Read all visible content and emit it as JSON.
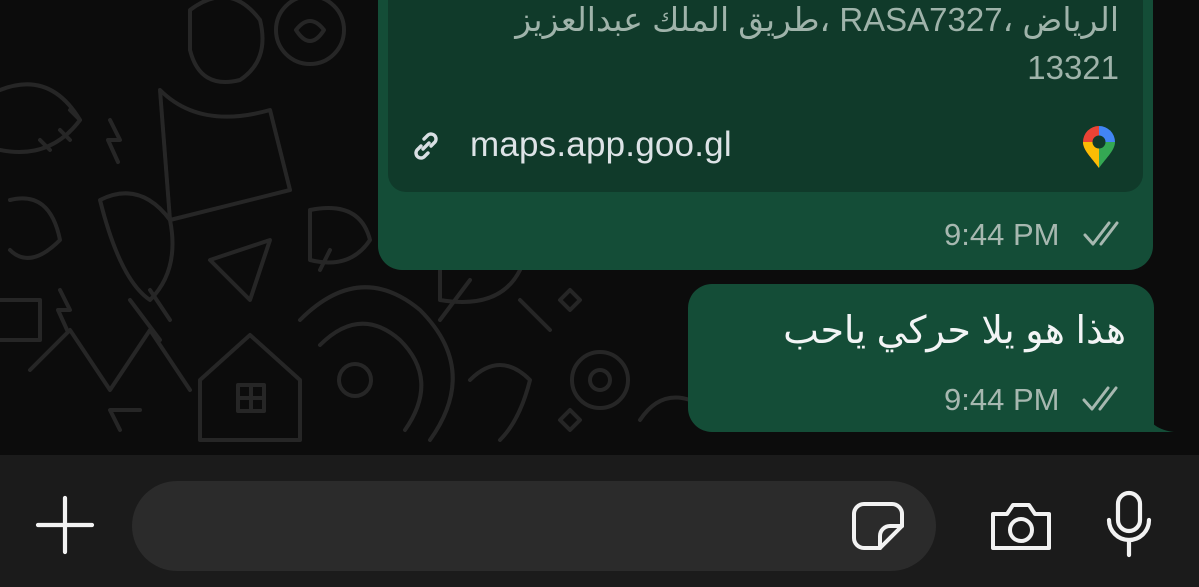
{
  "chat": {
    "location_message": {
      "address_line1": "طريق الملك عبدالعزيز، RASA7327، الرياض",
      "address_line2": "13321",
      "link_text": "maps.app.goo.gl",
      "time": "9:44 PM",
      "status": "read"
    },
    "text_message": {
      "text": "هذا هو يلا حركي ياحب",
      "time": "9:44 PM",
      "status": "read"
    }
  },
  "composer": {
    "value": "",
    "placeholder": ""
  },
  "icons": {
    "attach": "plus-icon",
    "sticker": "sticker-icon",
    "camera": "camera-icon",
    "microphone": "microphone-icon",
    "link": "link-icon",
    "map_pin": "google-maps-pin-icon",
    "read_receipt": "double-check-icon"
  },
  "colors": {
    "outgoing_bubble": "#144d37",
    "location_card": "#103a2a",
    "chat_background": "#0c0c0c",
    "input_bar": "#1b1b1b",
    "input_field": "#2b2b2b"
  }
}
